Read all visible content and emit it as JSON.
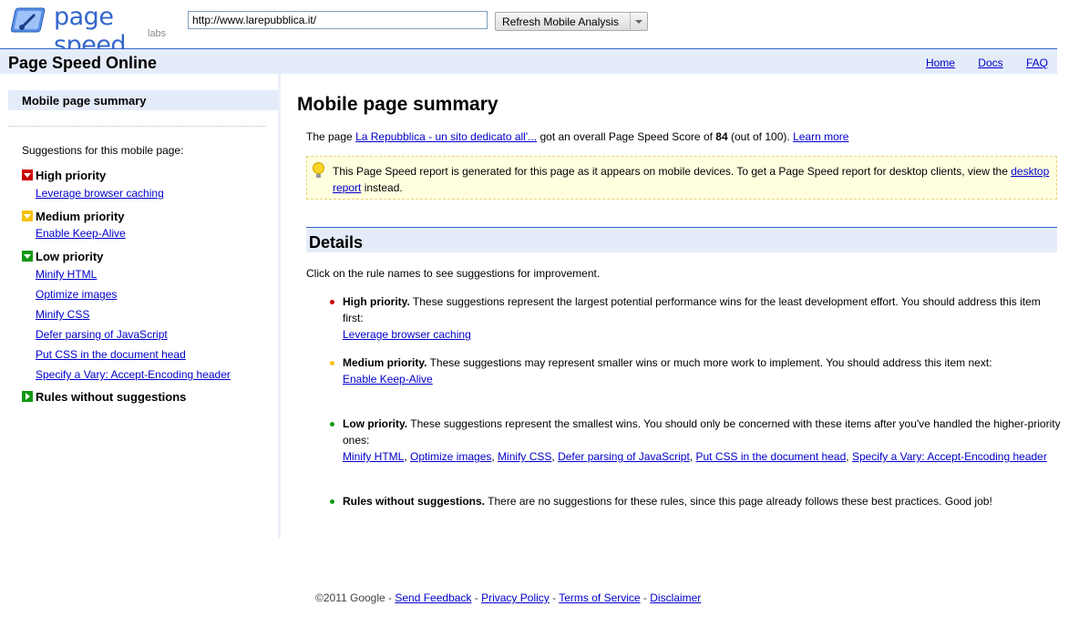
{
  "logo": {
    "title": "page speed",
    "subtitle": "labs"
  },
  "toolbar": {
    "url_value": "http://www.larepubblica.it/",
    "analyze_label": "Refresh Mobile Analysis"
  },
  "header": {
    "app_title": "Page Speed Online",
    "links": [
      "Home",
      "Docs",
      "FAQ"
    ]
  },
  "sidebar": {
    "selected": "Mobile page summary",
    "heading": "Suggestions for this mobile page:",
    "high": {
      "label": "High priority",
      "items": [
        "Leverage browser caching"
      ]
    },
    "medium": {
      "label": "Medium priority",
      "items": [
        "Enable Keep-Alive"
      ]
    },
    "low": {
      "label": "Low priority",
      "items": [
        "Minify HTML",
        "Optimize images",
        "Minify CSS",
        "Defer parsing of JavaScript",
        "Put CSS in the document head",
        "Specify a Vary: Accept-Encoding header"
      ]
    },
    "none": {
      "label": "Rules without suggestions"
    }
  },
  "main": {
    "title": "Mobile page summary",
    "score": {
      "prefix": "The page",
      "page_link": "La Repubblica - un sito dedicato all'...",
      "middle": "got an overall Page Speed Score of",
      "score": "84",
      "suffix": "(out of 100).",
      "learn_more": "Learn more"
    },
    "notice": {
      "text_before": "This Page Speed report is generated for this page as it appears on mobile devices. To get a Page Speed report for desktop clients, view the",
      "link": "desktop report",
      "text_after": "instead."
    },
    "details_title": "Details",
    "details_intro": "Click on the rule names to see suggestions for improvement.",
    "high": {
      "label": "High priority.",
      "text": "These suggestions represent the largest potential performance wins for the least development effort. You should address this item first:",
      "links": [
        "Leverage browser caching"
      ]
    },
    "medium": {
      "label": "Medium priority.",
      "text": "These suggestions may represent smaller wins or much more work to implement. You should address this item next:",
      "links": [
        "Enable Keep-Alive"
      ]
    },
    "low": {
      "label": "Low priority.",
      "text": "These suggestions represent the smallest wins. You should only be concerned with these items after you've handled the higher-priority ones:",
      "links": [
        "Minify HTML",
        "Optimize images",
        "Minify CSS",
        "Defer parsing of JavaScript",
        "Put CSS in the document head",
        "Specify a Vary: Accept-Encoding header"
      ]
    },
    "none": {
      "label": "Rules without suggestions.",
      "text": "There are no suggestions for these rules, since this page already follows these best practices. Good job!"
    }
  },
  "footer": {
    "copyright": "©2011 Google",
    "links": [
      "Send Feedback",
      "Privacy Policy",
      "Terms of Service",
      "Disclaimer"
    ]
  }
}
